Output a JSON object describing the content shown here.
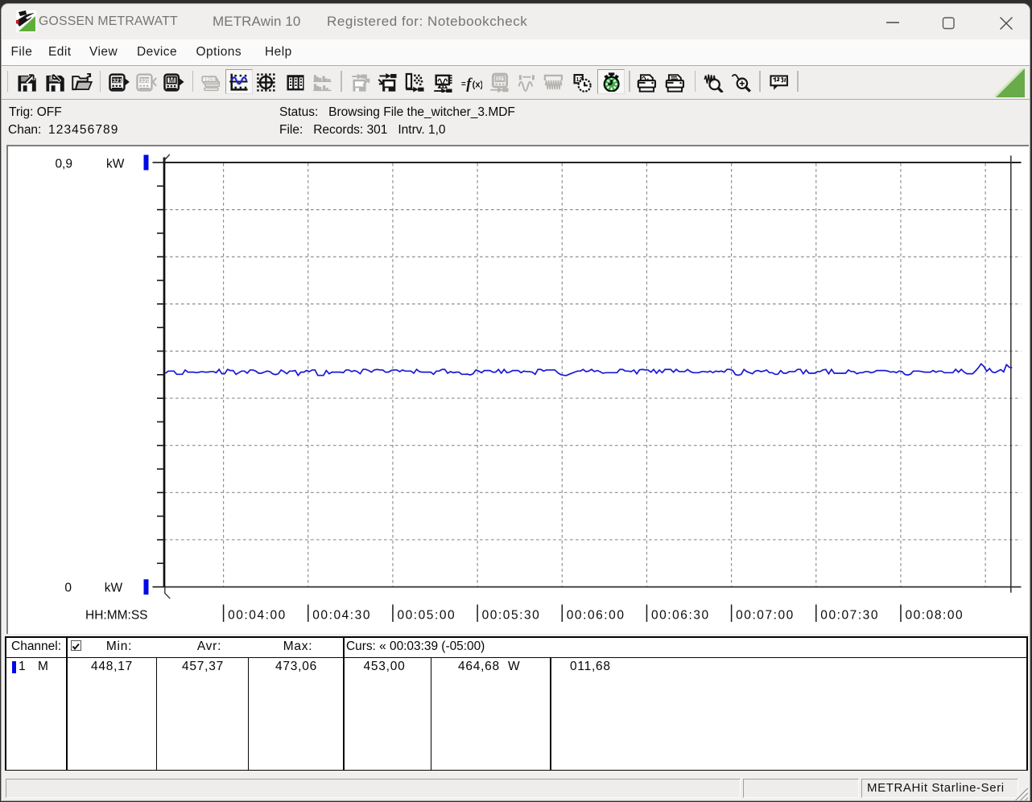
{
  "window": {
    "brand": "GOSSEN METRAWATT",
    "app_title": "METRAwin 10",
    "registered": "Registered for: Notebookcheck"
  },
  "menu": {
    "items": [
      "File",
      "Edit",
      "View",
      "Device",
      "Options",
      "Help"
    ]
  },
  "toolbar": {
    "groups": [
      [
        {
          "icon": "save-export-icon",
          "state": "normal"
        },
        {
          "icon": "save-import-icon",
          "state": "normal"
        },
        {
          "icon": "open-file-icon",
          "state": "normal"
        }
      ],
      [
        {
          "icon": "device-read-icon",
          "state": "normal"
        },
        {
          "icon": "device-read-stop-icon",
          "state": "disabled"
        },
        {
          "icon": "device-memory-icon",
          "state": "normal"
        }
      ],
      [
        {
          "icon": "multimeter-display-icon",
          "state": "disabled"
        },
        {
          "icon": "chart-view-icon",
          "state": "pressed"
        },
        {
          "icon": "crosshair-cursor-icon",
          "state": "normal"
        },
        {
          "icon": "table-view-icon",
          "state": "normal"
        },
        {
          "icon": "histogram-view-icon",
          "state": "disabled"
        }
      ],
      [
        {
          "icon": "config-save-icon",
          "state": "disabled"
        },
        {
          "icon": "config-load-icon",
          "state": "normal"
        },
        {
          "icon": "channel-setup-icon",
          "state": "normal"
        },
        {
          "icon": "display-setup-icon",
          "state": "normal"
        },
        {
          "icon": "formula-fx-icon",
          "state": "normal"
        },
        {
          "icon": "device-offline-icon",
          "state": "disabled"
        },
        {
          "icon": "wave-cursors-icon",
          "state": "disabled"
        },
        {
          "icon": "wave-envelope-icon",
          "state": "disabled"
        },
        {
          "icon": "date-time-icon",
          "state": "normal"
        },
        {
          "icon": "stopwatch-icon",
          "state": "pressed"
        }
      ],
      [
        {
          "icon": "print-chart-icon",
          "state": "normal"
        },
        {
          "icon": "print-icon",
          "state": "normal"
        }
      ],
      [
        {
          "icon": "zoom-in-wave-icon",
          "state": "normal"
        },
        {
          "icon": "zoom-out-wave-icon",
          "state": "normal"
        }
      ],
      [
        {
          "icon": "annotation-icon",
          "state": "normal"
        }
      ]
    ]
  },
  "info_panel": {
    "trig_label": "Trig:",
    "trig_value": "OFF",
    "chan_label": "Chan:",
    "chan_value": "123456789",
    "status_label": "Status:",
    "status_value": "Browsing File the_witcher_3.MDF",
    "file_label": "File:",
    "records_label": "Records:",
    "records_value": "301",
    "interval_label": "Intrv.",
    "interval_value": "1,0"
  },
  "chart_data": {
    "type": "line",
    "title": "",
    "ylabel": "kW",
    "xlabel": "HH:MM:SS",
    "y_axis": {
      "max_label": "0,9",
      "min_label": "0",
      "unit": "kW",
      "min_w": 0,
      "max_w": 900,
      "grid_step_w": 100,
      "tick_step_w": 50
    },
    "x_axis": {
      "label": "HH:MM:SS",
      "tick_labels": [
        "00:04:00",
        "00:04:30",
        "00:05:00",
        "00:05:30",
        "00:06:00",
        "00:06:30",
        "00:07:00",
        "00:07:30",
        "00:08:00"
      ],
      "start_time": "00:03:39",
      "end_time": "00:08:39",
      "first_tick_offset_s": 21,
      "tick_interval_s": 30,
      "total_s": 300,
      "grid_count": 10
    },
    "grid": true,
    "cursors": {
      "cursor1_time": "00:03:39",
      "cursor1_value_w": 453.0,
      "cursor2_value_w": 464.68,
      "delta_w": 11.68
    },
    "series": [
      {
        "name": "Channel 1",
        "color": "#1a18d4",
        "unit": "W",
        "min_w": 448.17,
        "avg_w": 457.37,
        "max_w": 473.06,
        "interval_s": 1.0,
        "values_w": [
          453.0,
          457.7,
          457.7,
          457.7,
          450.8,
          450.8,
          450.8,
          460.0,
          455.4,
          455.4,
          455.4,
          454.25,
          455.4,
          456.55,
          455.4,
          455.4,
          456.55,
          456.55,
          454.25,
          461.3,
          451.95,
          451.95,
          461.3,
          458.85,
          458.85,
          450.8,
          454.25,
          457.7,
          457.7,
          453.1,
          460.0,
          460.0,
          457.7,
          453.1,
          453.1,
          455.4,
          457.7,
          456.55,
          451.9,
          450.1,
          451.9,
          460.0,
          456.55,
          451.95,
          457.7,
          457.7,
          458.85,
          448.5,
          455.4,
          455.4,
          458.85,
          456.55,
          460.0,
          460.0,
          448.5,
          448.5,
          448.5,
          458.85,
          451.95,
          455.4,
          455.4,
          455.4,
          455.4,
          454.25,
          460.0,
          460.0,
          456.55,
          458.85,
          456.55,
          451.95,
          461.3,
          461.3,
          458.85,
          455.4,
          460.1,
          461.2,
          460.0,
          460.0,
          455.4,
          455.4,
          458.85,
          460.0,
          460.0,
          456.55,
          460.0,
          457.7,
          457.7,
          457.7,
          453.1,
          461.3,
          456.55,
          455.4,
          455.4,
          455.4,
          455.4,
          450.8,
          457.7,
          457.7,
          461.15,
          461.15,
          453.1,
          456.55,
          454.25,
          455.4,
          455.4,
          450.8,
          450.8,
          451.1,
          449.5,
          451.95,
          460.0,
          457.7,
          454.25,
          458.85,
          458.85,
          458.85,
          455.4,
          455.4,
          461.15,
          453.1,
          461.15,
          454.25,
          455.4,
          458.85,
          458.85,
          458.85,
          454.25,
          457.7,
          456.55,
          456.55,
          455.4,
          450.8,
          461.15,
          461.15,
          457.7,
          460.0,
          460.0,
          460.0,
          460.0,
          454.25,
          450.3,
          448.9,
          448.17,
          450.8,
          453.1,
          455.4,
          457.7,
          457.7,
          461.15,
          456.55,
          457.7,
          461.3,
          456.55,
          458.85,
          456.55,
          453.1,
          454.25,
          454.25,
          454.25,
          454.25,
          454.25,
          461.15,
          461.15,
          457.7,
          457.7,
          456.55,
          460.0,
          451.95,
          460.4,
          461.2,
          460.1,
          460.0,
          455.4,
          461.15,
          453.1,
          460.0,
          454.25,
          461.15,
          461.15,
          461.15,
          455.4,
          461.3,
          456.55,
          456.55,
          456.55,
          461.15,
          456.55,
          454.25,
          454.25,
          454.25,
          456.55,
          456.55,
          455.4,
          457.7,
          454.25,
          457.7,
          456.55,
          457.7,
          455.4,
          461.3,
          461.3,
          458.85,
          450.1,
          448.8,
          450.9,
          461.15,
          456.55,
          454.25,
          451.95,
          457.7,
          458.85,
          456.55,
          457.7,
          460.0,
          454.25,
          454.25,
          450.8,
          450.8,
          458.85,
          453.1,
          453.1,
          456.55,
          456.55,
          456.55,
          461.3,
          461.3,
          451.95,
          460.0,
          453.1,
          453.1,
          453.1,
          456.55,
          456.55,
          460.2,
          461.1,
          451.95,
          461.15,
          453.1,
          453.1,
          453.1,
          453.1,
          453.1,
          460.0,
          456.55,
          456.55,
          451.95,
          454.25,
          454.25,
          456.55,
          456.55,
          454.25,
          455.4,
          458.85,
          458.85,
          458.85,
          458.85,
          457.7,
          455.4,
          456.55,
          454.25,
          457.7,
          456.55,
          450.5,
          449.3,
          451.2,
          457.7,
          457.7,
          457.7,
          456.55,
          455.4,
          455.4,
          455.4,
          458.85,
          455.4,
          457.7,
          457.7,
          454.25,
          454.25,
          454.25,
          454.25,
          461.3,
          455.4,
          461.3,
          455.4,
          451.95,
          451.95,
          451.95,
          457.8,
          464.5,
          473.06,
          467.5,
          457.2,
          463.0,
          455.6,
          454.4,
          457.8,
          460.8,
          455.9,
          471.3,
          465.8,
          464.68
        ]
      }
    ]
  },
  "table": {
    "header": {
      "channel": "Channel:",
      "checkbox_checked": true,
      "min": "Min:",
      "avr": "Avr:",
      "max": "Max:",
      "cursor": "Curs: « 00:03:39 (-05:00)"
    },
    "row": {
      "channel_num": "1",
      "channel_mode": "M",
      "channel_color": "#0009e6",
      "min": "448,17",
      "avr": "457,37",
      "max": "473,06",
      "curs1": "453,00",
      "curs2": "464,68",
      "unit": "W",
      "delta": "011,68"
    }
  },
  "status_bar": {
    "device": "METRAHit Starline-Seri"
  },
  "colors": {
    "accent_blue": "#0009e6",
    "trace_blue": "#1a18d4",
    "logo_green": "#5fae3c",
    "logo_red": "#cc1122",
    "triangle_green": "#69aa49",
    "chrome_bg": "#f0efed"
  }
}
